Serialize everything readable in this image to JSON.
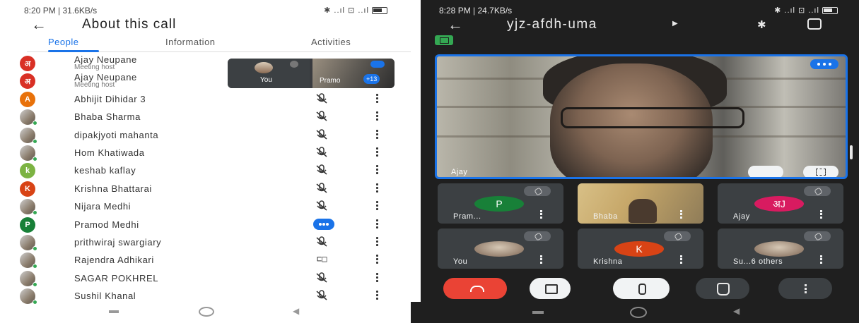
{
  "left": {
    "status_time": "8:20 PM | 31.6KB/s",
    "status_right": "✱ ..ıl ⊡ ..ıl",
    "title": "About this call",
    "tabs": [
      {
        "label": "People"
      },
      {
        "label": "Information"
      },
      {
        "label": "Activities"
      }
    ],
    "pip": {
      "self_label": "You",
      "other_label": "Pramo",
      "count": "+13"
    },
    "participants": [
      {
        "avatar": "अ",
        "color": "#d93025",
        "name": "Ajay Neupane",
        "sub": "Meeting host",
        "state": "none"
      },
      {
        "avatar": "अ",
        "color": "#d93025",
        "name": "Ajay Neupane",
        "sub": "Meeting host",
        "state": "none"
      },
      {
        "avatar": "A",
        "color": "#e8710a",
        "name": "Abhijit Dihidar 3",
        "sub": "",
        "state": "muted"
      },
      {
        "avatar": "",
        "color": "",
        "name": "Bhaba Sharma",
        "sub": "",
        "state": "muted"
      },
      {
        "avatar": "",
        "color": "",
        "name": "dipakjyoti mahanta",
        "sub": "",
        "state": "muted"
      },
      {
        "avatar": "",
        "color": "",
        "name": "Hom Khatiwada",
        "sub": "",
        "state": "muted"
      },
      {
        "avatar": "k",
        "color": "#7cb342",
        "name": "keshab kaflay",
        "sub": "",
        "state": "muted"
      },
      {
        "avatar": "K",
        "color": "#d84315",
        "name": "Krishna Bhattarai",
        "sub": "",
        "state": "muted"
      },
      {
        "avatar": "",
        "color": "",
        "name": "Nijara Medhi",
        "sub": "",
        "state": "muted"
      },
      {
        "avatar": "P",
        "color": "#188038",
        "name": "Pramod Medhi",
        "sub": "",
        "state": "speaking"
      },
      {
        "avatar": "",
        "color": "",
        "name": "prithwiraj swargiary",
        "sub": "",
        "state": "muted"
      },
      {
        "avatar": "",
        "color": "",
        "name": "Rajendra Adhikari",
        "sub": "",
        "state": "presenting"
      },
      {
        "avatar": "",
        "color": "",
        "name": "SAGAR POKHREL",
        "sub": "",
        "state": "muted"
      },
      {
        "avatar": "",
        "color": "",
        "name": "Sushil Khanal",
        "sub": "",
        "state": "muted"
      }
    ]
  },
  "right": {
    "status_time": "8:28 PM | 24.7KB/s",
    "status_right": "✱ ..ıl ⊡ ..ıl",
    "meeting_code": "yjz-afdh-uma",
    "main_label": "Ajay",
    "tiles": [
      {
        "label": "Pram...",
        "avatar": "P",
        "color": "#188038",
        "kind": "letter"
      },
      {
        "label": "Bhaba",
        "avatar": "",
        "color": "",
        "kind": "video"
      },
      {
        "label": "Ajay",
        "avatar": "अJ",
        "color": "#d81b60",
        "kind": "letter"
      },
      {
        "label": "You",
        "avatar": "",
        "color": "",
        "kind": "photo"
      },
      {
        "label": "Krishna",
        "avatar": "K",
        "color": "#d84315",
        "kind": "letter"
      },
      {
        "label": "Su...6 others",
        "avatar": "",
        "color": "",
        "kind": "photo"
      }
    ]
  },
  "colors": {
    "accent": "#1a73e8",
    "end_call": "#ea4335",
    "online": "#34a853"
  }
}
